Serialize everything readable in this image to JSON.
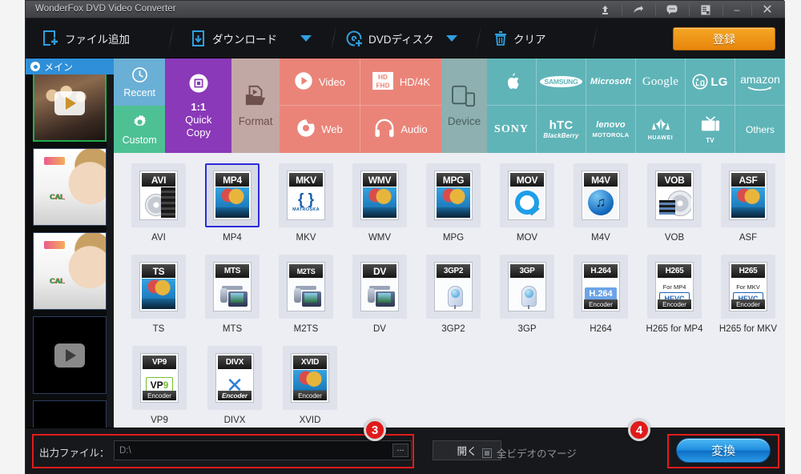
{
  "window": {
    "title": "WonderFox DVD Video Converter",
    "sysicons": [
      "upload-icon",
      "share-icon",
      "feedback-icon",
      "log-icon"
    ],
    "minimize_label": "–",
    "close_label": "✕"
  },
  "toolbar": {
    "add_file": "ファイル追加",
    "download": "ダウンロード",
    "dvd_disc": "DVDディスク",
    "clear": "クリア",
    "register": "登録"
  },
  "thumbnails": {
    "main_tab_label": "メイン",
    "items": [
      {
        "name": "thumbnail-1",
        "selected": true
      },
      {
        "name": "thumbnail-2",
        "selected": false
      },
      {
        "name": "thumbnail-3",
        "selected": false
      },
      {
        "name": "thumbnail-4",
        "selected": false
      },
      {
        "name": "thumbnail-5",
        "selected": false
      }
    ]
  },
  "categories": {
    "recent": "Recent",
    "custom": "Custom",
    "quick_copy_ratio": "1:1",
    "quick_copy_line1": "Quick",
    "quick_copy_line2": "Copy",
    "format": "Format",
    "video": "Video",
    "hd4k": "HD/4K",
    "hd4k_badge_top": "HD",
    "hd4k_badge_bottom": "FHD",
    "web": "Web",
    "audio": "Audio",
    "device": "Device",
    "brands_row1": [
      "Apple",
      "SAMSUNG",
      "Microsoft",
      "Google",
      "LG",
      "amazon"
    ],
    "brands_row2": [
      "SONY",
      "hTC / BlackBerry",
      "lenovo / MOTOROLA",
      "HUAWEI",
      "TV",
      "Others"
    ],
    "brand_labels": {
      "samsung": "SAMSUNG",
      "microsoft": "Microsoft",
      "google": "Google",
      "lg": "LG",
      "amazon": "amazon",
      "sony": "SONY",
      "htc": "hTC",
      "blackberry": "BlackBerry",
      "lenovo": "lenovo",
      "motorola": "MOTOROLA",
      "huawei": "HUAWEI",
      "tv": "TV",
      "others": "Others"
    }
  },
  "formats": {
    "selected": "MP4",
    "rows": [
      [
        {
          "label": "AVI",
          "tile": "AVI",
          "art": "disc-film"
        },
        {
          "label": "MP4",
          "tile": "MP4",
          "art": "balloon",
          "selected": true
        },
        {
          "label": "MKV",
          "tile": "MKV",
          "art": "matroska",
          "sub": "MATROSKA"
        },
        {
          "label": "WMV",
          "tile": "WMV",
          "art": "balloon"
        },
        {
          "label": "MPG",
          "tile": "MPG",
          "art": "balloon"
        },
        {
          "label": "MOV",
          "tile": "MOV",
          "art": "quicktime"
        },
        {
          "label": "M4V",
          "tile": "M4V",
          "art": "itunes"
        },
        {
          "label": "VOB",
          "tile": "VOB",
          "art": "disc-film"
        },
        {
          "label": "ASF",
          "tile": "ASF",
          "art": "balloon"
        }
      ],
      [
        {
          "label": "TS",
          "tile": "TS",
          "art": "balloon"
        },
        {
          "label": "MTS",
          "tile": "MTS",
          "art": "camcorder"
        },
        {
          "label": "M2TS",
          "tile": "M2TS",
          "art": "camcorder"
        },
        {
          "label": "DV",
          "tile": "DV",
          "art": "camcorder"
        },
        {
          "label": "3GP2",
          "tile": "3GP2",
          "art": "phone"
        },
        {
          "label": "3GP",
          "tile": "3GP",
          "art": "phone"
        },
        {
          "label": "H264",
          "tile": "H.264",
          "art": "encoder",
          "badge": "H.264",
          "foot": "Encoder"
        },
        {
          "label": "H265 for MP4",
          "tile": "H265",
          "art": "encoder",
          "sub": "For MP4",
          "badge": "HEVC",
          "foot": "Encoder"
        },
        {
          "label": "H265 for MKV",
          "tile": "H265",
          "art": "encoder",
          "sub": "For MKV",
          "badge": "HEVC",
          "foot": "Encoder"
        }
      ],
      [
        {
          "label": "VP9",
          "tile": "VP9",
          "art": "encoder",
          "badge": "VP9",
          "foot": "Encoder"
        },
        {
          "label": "DIVX",
          "tile": "DIVX",
          "art": "divx",
          "foot": "Encoder"
        },
        {
          "label": "XVID",
          "tile": "XVID",
          "art": "balloon",
          "foot": "Encoder"
        }
      ]
    ]
  },
  "bottom": {
    "output_label": "出力ファイル：",
    "output_value": "D:\\",
    "output_placeholder": "D:\\",
    "browse_label": "...",
    "open_label": "開く",
    "merge_label": "全ビデオのマージ",
    "merge_checked": false,
    "convert_label": "変換"
  },
  "annotations": [
    {
      "badge": "3",
      "target": "output-file-row"
    },
    {
      "badge": "4",
      "target": "convert-button"
    }
  ],
  "colors": {
    "accent_orange": "#f0960f",
    "accent_blue": "#1f8fe0",
    "annotation_red": "#e31b1b",
    "recent_blue": "#6aafd5",
    "custom_green": "#4ec194",
    "quick_purple": "#8a39b8",
    "format_mauve": "#c2a8a4",
    "media_salmon": "#ea8479",
    "brand_teal": "#5fb4b8"
  }
}
